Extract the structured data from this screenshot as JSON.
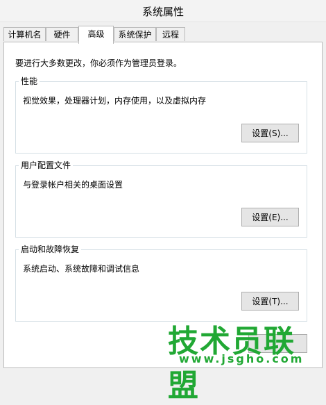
{
  "window": {
    "title": "系统属性"
  },
  "tabs": [
    {
      "label": "计算机名"
    },
    {
      "label": "硬件"
    },
    {
      "label": "高级"
    },
    {
      "label": "系统保护"
    },
    {
      "label": "远程"
    }
  ],
  "active_tab": "高级",
  "notice": "要进行大多数更改，你必须作为管理员登录。",
  "groups": {
    "performance": {
      "title": "性能",
      "desc": "视觉效果，处理器计划，内存使用，以及虚拟内存",
      "button": "设置(S)..."
    },
    "user_profiles": {
      "title": "用户配置文件",
      "desc": "与登录帐户相关的桌面设置",
      "button": "设置(E)..."
    },
    "startup_recovery": {
      "title": "启动和故障恢复",
      "desc": "系统启动、系统故障和调试信息",
      "button": "设置(T)..."
    }
  },
  "watermark": {
    "brand": "技术员联盟",
    "url": "www.jsgho.com"
  },
  "colors": {
    "watermark": "#21a834"
  }
}
